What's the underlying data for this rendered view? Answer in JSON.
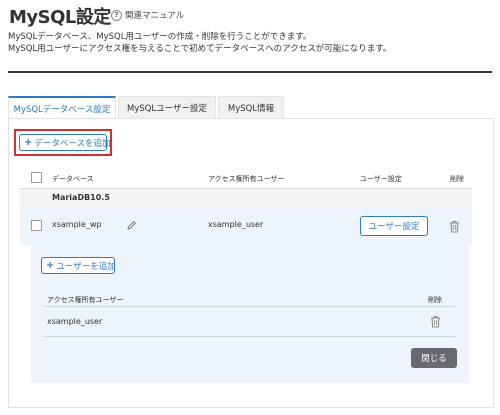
{
  "page": {
    "title": "MySQL設定",
    "help_link": "関連マニュアル",
    "description": [
      "MySQLデータベース、MySQL用ユーザーの作成・削除を行うことができます。",
      "MySQL用ユーザーにアクセス権を与えることで初めてデータベースへのアクセスが可能になります。"
    ]
  },
  "tabs": [
    {
      "label": "MySQLデータベース設定",
      "active": true
    },
    {
      "label": "MySQLユーザー設定",
      "active": false
    },
    {
      "label": "MySQL情報",
      "active": false
    }
  ],
  "toolbar": {
    "add_database_label": "データベースを追加"
  },
  "table": {
    "columns": {
      "database": "データベース",
      "access_users": "アクセス権所有ユーザー",
      "user_settings": "ユーザー設定",
      "delete": "削除"
    },
    "groups": [
      {
        "label": "MariaDB10.5",
        "rows": [
          {
            "database": "xsample_wp",
            "access_user": "xsample_user",
            "user_settings_button": "ユーザー設定"
          }
        ]
      }
    ]
  },
  "user_panel": {
    "add_user_label": "ユーザーを追加",
    "columns": {
      "access_users": "アクセス権所有ユーザー",
      "delete": "削除"
    },
    "rows": [
      {
        "user": "xsample_user"
      }
    ],
    "close_label": "閉じる"
  },
  "colors": {
    "accent": "#2f7cc1",
    "highlight_outline": "#d23030",
    "selected_row_bg": "#eef4fb",
    "close_button_bg": "#666a6e"
  },
  "icons": {
    "help": "question-circle-icon",
    "edit": "pencil-icon",
    "delete": "trash-icon",
    "add": "plus-icon"
  }
}
